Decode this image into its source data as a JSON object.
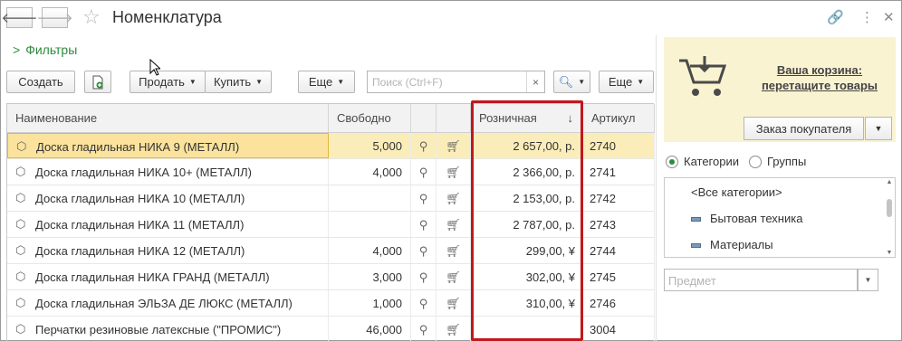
{
  "window": {
    "title": "Номенклатура",
    "back_icon": "arrow-left",
    "forward_icon": "arrow-right",
    "star_icon": "star",
    "link_icon": "link",
    "more_icon": "vertical-dots",
    "close_icon": "close"
  },
  "filters": {
    "label": "Фильтры",
    "icon": "chevron-right"
  },
  "toolbar": {
    "create": "Создать",
    "sell": "Продать",
    "buy": "Купить",
    "more1": "Еще",
    "search_placeholder": "Поиск (Ctrl+F)",
    "search_clear": "×",
    "more2": "Еще"
  },
  "table": {
    "columns": [
      "Наименование",
      "Свободно",
      "",
      "",
      "Розничная",
      "Артикул"
    ],
    "sort_indicator": "↓",
    "rows": [
      {
        "name": "Доска гладильная  НИКА 9 (МЕТАЛЛ)",
        "free": "5,000",
        "price": "2 657,00, р.",
        "article": "2740",
        "selected": true
      },
      {
        "name": "Доска гладильная  НИКА 10+ (МЕТАЛЛ)",
        "free": "4,000",
        "price": "2 366,00, р.",
        "article": "2741"
      },
      {
        "name": "Доска гладильная  НИКА 10 (МЕТАЛЛ)",
        "free": "",
        "price": "2 153,00, р.",
        "article": "2742"
      },
      {
        "name": "Доска гладильная  НИКА 11 (МЕТАЛЛ)",
        "free": "",
        "price": "2 787,00, р.",
        "article": "2743"
      },
      {
        "name": "Доска гладильная  НИКА 12 (МЕТАЛЛ)",
        "free": "4,000",
        "price": "299,00, ¥",
        "article": "2744"
      },
      {
        "name": "Доска гладильная  НИКА ГРАНД (МЕТАЛЛ)",
        "free": "3,000",
        "price": "302,00, ¥",
        "article": "2745"
      },
      {
        "name": "Доска гладильная  ЭЛЬЗА ДЕ ЛЮКС (МЕТАЛЛ)",
        "free": "1,000",
        "price": "310,00, ¥",
        "article": "2746"
      },
      {
        "name": "Перчатки резиновые латексные (\"ПРОМИС\")",
        "free": "46,000",
        "price": "",
        "article": "3004"
      }
    ]
  },
  "cart": {
    "line1": "Ваша корзина:",
    "line2": "перетащите товары",
    "order_button": "Заказ покупателя"
  },
  "view_mode": {
    "categories": "Категории",
    "groups": "Группы",
    "selected": "categories"
  },
  "categories": [
    "<Все категории>",
    "Бытовая техника",
    "Материалы"
  ],
  "subject": {
    "placeholder": "Предмет"
  },
  "colors": {
    "accent_green": "#2e8b3e",
    "selected_row": "#fbedb9",
    "highlight_border": "#c0181f"
  }
}
